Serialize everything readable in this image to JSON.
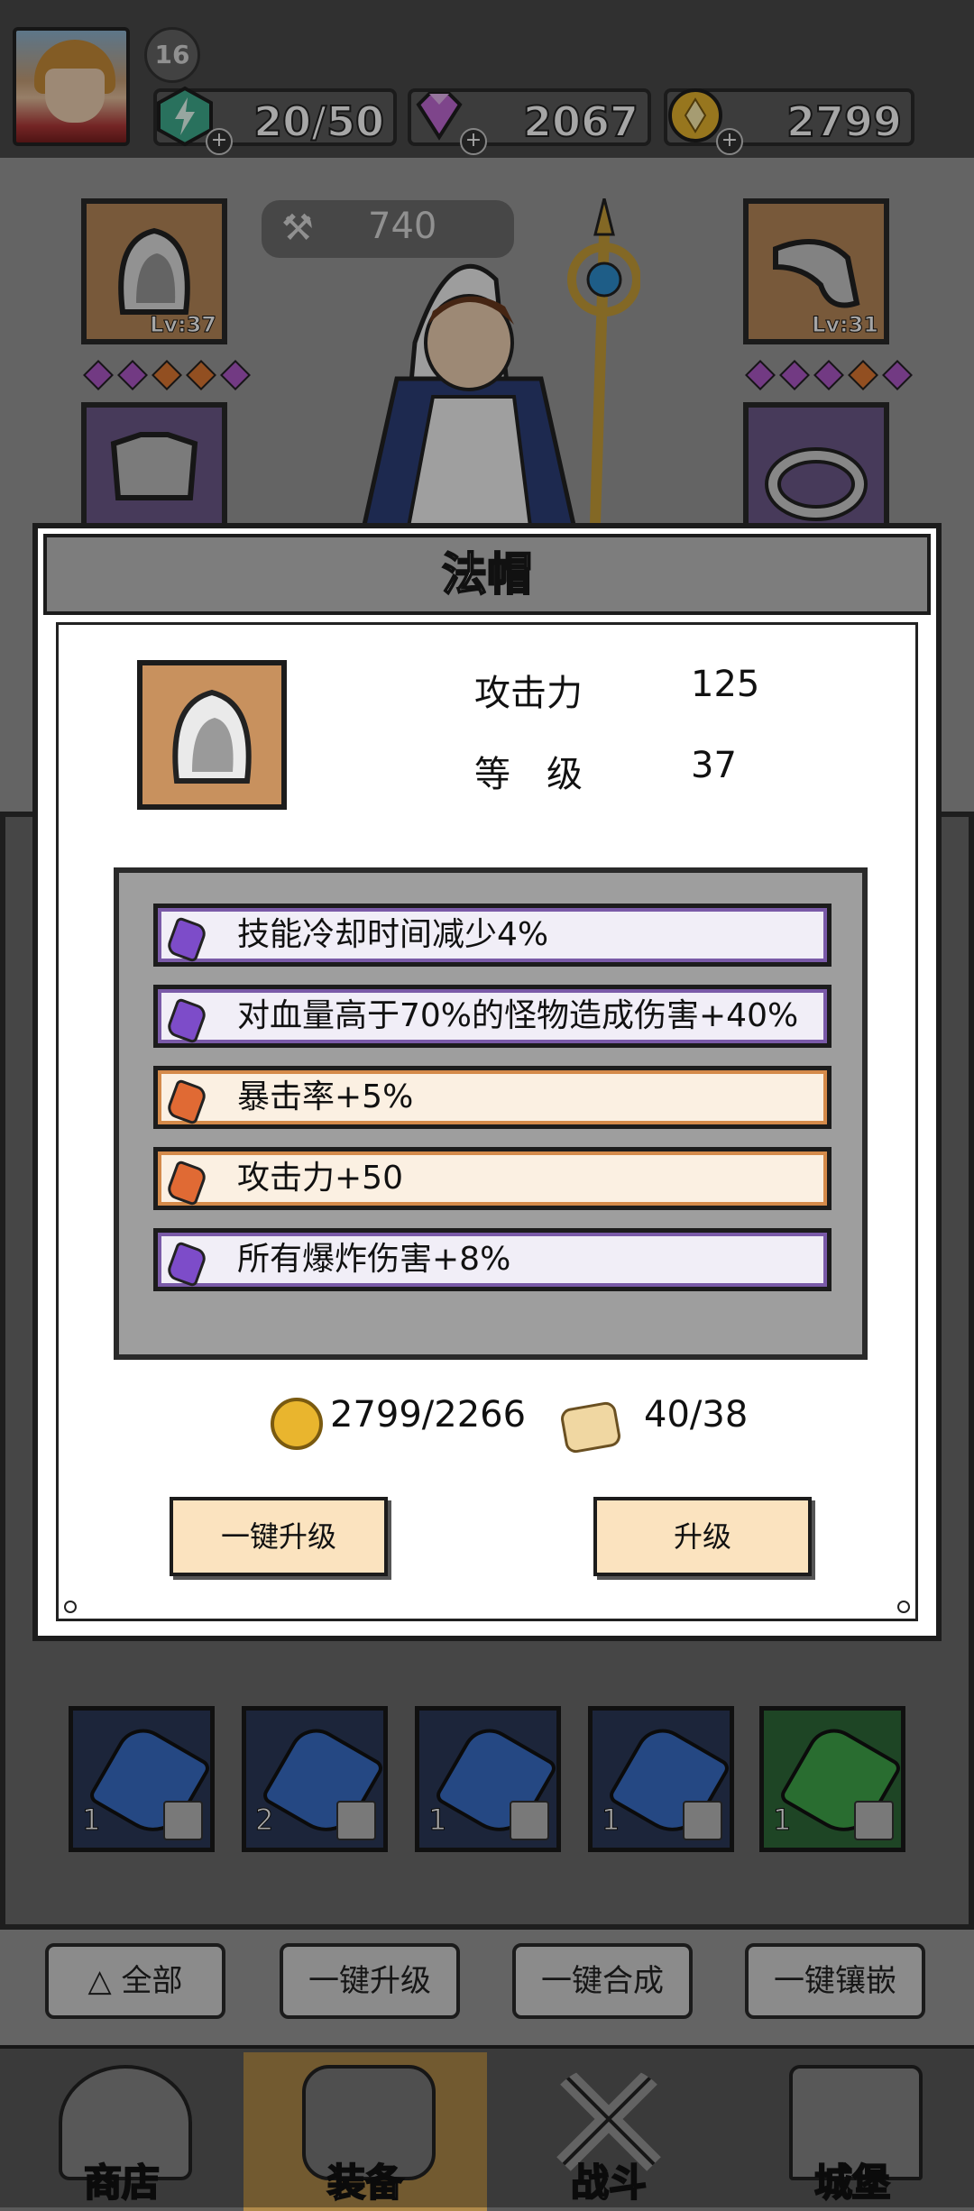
{
  "top_bar": {
    "player_level": "16",
    "energy": "20/50",
    "gems": "2067",
    "gold": "2799"
  },
  "character": {
    "power": "740",
    "slots": [
      {
        "name": "hood",
        "level": "Lv:37"
      },
      {
        "name": "gloves",
        "level": "Lv:31"
      }
    ]
  },
  "inventory": {
    "gem_counts": [
      "1",
      "2",
      "1",
      "1",
      "1"
    ]
  },
  "actions": {
    "filter_label": "全部",
    "upgrade_all_label": "一键升级",
    "merge_all_label": "一键合成",
    "inlay_all_label": "一键镶嵌"
  },
  "nav": {
    "items": [
      {
        "label": "商店",
        "icon": "shop-icon"
      },
      {
        "label": "装备",
        "icon": "backpack-icon"
      },
      {
        "label": "战斗",
        "icon": "crossed-swords-icon"
      },
      {
        "label": "城堡",
        "icon": "castle-icon"
      }
    ],
    "active": "装备"
  },
  "modal": {
    "title": "法帽",
    "stats": [
      {
        "key": "攻击力",
        "value": "125"
      },
      {
        "key": "等　级",
        "value": "37"
      }
    ],
    "affixes": [
      {
        "text": "技能冷却时间减少4%",
        "color": "purple"
      },
      {
        "text": "对血量高于70%的怪物造成伤害+40%",
        "color": "purple"
      },
      {
        "text": "暴击率+5%",
        "color": "orange"
      },
      {
        "text": "攻击力+50",
        "color": "orange"
      },
      {
        "text": "所有爆炸伤害+8%",
        "color": "purple"
      }
    ],
    "gold_cost": "2799/2266",
    "scroll_cost": "40/38",
    "upgrade_all_button": "一键升级",
    "upgrade_button": "升级"
  },
  "colors": {
    "purple_affix": "#7a5aa8",
    "orange_affix": "#d48a4a",
    "button_fill": "#fbe3bf"
  }
}
